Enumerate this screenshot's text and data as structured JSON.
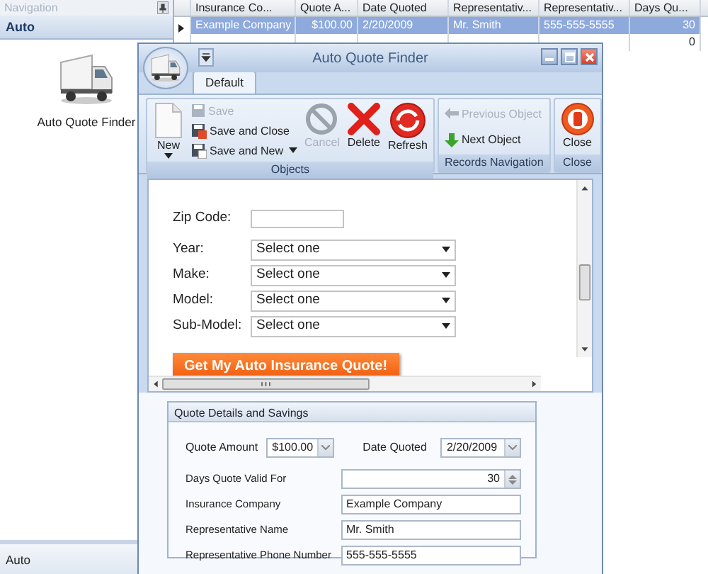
{
  "navigation": {
    "title": "Navigation",
    "group": "Auto",
    "items": [
      {
        "label": "Auto Quote Finder"
      }
    ],
    "footer": "Auto"
  },
  "grid": {
    "columns": [
      "Insurance Co...",
      "Quote A...",
      "Date Quoted",
      "Representativ...",
      "Representativ...",
      "Days Qu..."
    ],
    "rows": [
      {
        "selected": true,
        "cells": [
          "Example Company",
          "$100.00",
          "2/20/2009",
          "Mr. Smith",
          "555-555-5555",
          "30"
        ]
      },
      {
        "selected": false,
        "cells": [
          "",
          "",
          "",
          "",
          "",
          "0"
        ]
      }
    ]
  },
  "dialog": {
    "title": "Auto Quote Finder",
    "tabs": [
      {
        "label": "Default",
        "selected": true
      }
    ],
    "ribbon_groups": [
      {
        "label": "Objects",
        "items": [
          {
            "label": "New",
            "kind": "large",
            "disabled": false,
            "dropdown": true
          },
          {
            "label": "Save",
            "kind": "small",
            "disabled": true,
            "dropdown": false
          },
          {
            "label": "Save and Close",
            "kind": "small",
            "disabled": false,
            "dropdown": false
          },
          {
            "label": "Save and New",
            "kind": "small",
            "disabled": false,
            "dropdown": true
          },
          {
            "label": "Cancel",
            "kind": "large",
            "disabled": true,
            "dropdown": false
          },
          {
            "label": "Delete",
            "kind": "large",
            "disabled": false,
            "dropdown": false
          },
          {
            "label": "Refresh",
            "kind": "large",
            "disabled": false,
            "dropdown": false
          }
        ]
      },
      {
        "label": "Records Navigation",
        "items": [
          {
            "label": "Previous Object",
            "kind": "small",
            "disabled": true,
            "dropdown": false
          },
          {
            "label": "Next Object",
            "kind": "small",
            "disabled": false,
            "dropdown": false
          }
        ]
      },
      {
        "label": "Close",
        "items": [
          {
            "label": "Close",
            "kind": "large",
            "disabled": false,
            "dropdown": false
          }
        ]
      }
    ]
  },
  "form": {
    "fields": [
      {
        "kind": "text",
        "label": "Zip Code:"
      },
      {
        "kind": "select",
        "label": "Year:",
        "value": "Select one"
      },
      {
        "kind": "select",
        "label": "Make:",
        "value": "Select one"
      },
      {
        "kind": "select",
        "label": "Model:",
        "value": "Select one"
      },
      {
        "kind": "select",
        "label": "Sub-Model:",
        "value": "Select one"
      }
    ],
    "submit": "Get My Auto Insurance Quote!"
  },
  "details": {
    "title": "Quote Details and Savings",
    "fields": [
      {
        "kind": "dropdown",
        "label": "Quote Amount",
        "value": "$100.00"
      },
      {
        "kind": "dropdown",
        "label": "Date Quoted",
        "value": "2/20/2009"
      },
      {
        "kind": "spin",
        "label": "Days Quote Valid For",
        "value": "30"
      },
      {
        "kind": "text",
        "label": "Insurance Company",
        "value": "Example Company"
      },
      {
        "kind": "text",
        "label": "Representative Name",
        "value": "Mr. Smith"
      },
      {
        "kind": "text",
        "label": "Representative Phone Number",
        "value": "555-555-5555"
      }
    ]
  }
}
